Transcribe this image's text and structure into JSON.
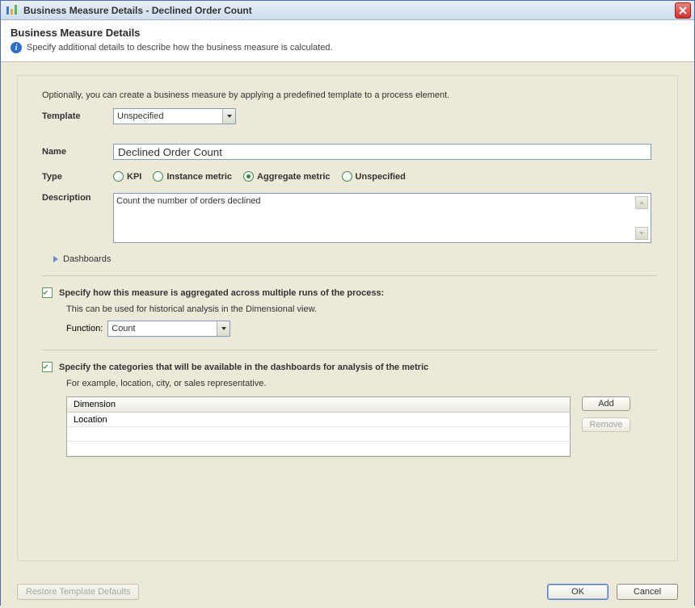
{
  "window": {
    "title": "Business Measure Details - Declined Order Count"
  },
  "header": {
    "title": "Business Measure Details",
    "subtitle": "Specify additional details to describe how the business measure is calculated."
  },
  "intro": "Optionally, you can create a business measure by applying a predefined template to a process element.",
  "labels": {
    "template": "Template",
    "name": "Name",
    "type": "Type",
    "description": "Description",
    "dashboards": "Dashboards",
    "function": "Function:"
  },
  "template": {
    "value": "Unspecified"
  },
  "name_value": "Declined Order Count",
  "type_options": {
    "kpi": "KPI",
    "instance": "Instance metric",
    "aggregate": "Aggregate metric",
    "unspecified": "Unspecified"
  },
  "description_value": "Count the number of orders declined",
  "aggregate_section": {
    "check_label": "Specify how this measure is aggregated across multiple runs of the process:",
    "desc": "This can be used for historical analysis in the Dimensional view.",
    "function_value": "Count"
  },
  "categories_section": {
    "check_label": "Specify the categories that will be available in the dashboards for analysis of the metric",
    "desc": "For example, location, city, or sales representative.",
    "table_header": "Dimension",
    "rows": [
      "Location",
      "",
      ""
    ],
    "add": "Add",
    "remove": "Remove"
  },
  "buttons": {
    "restore": "Restore Template Defaults",
    "ok": "OK",
    "cancel": "Cancel"
  }
}
